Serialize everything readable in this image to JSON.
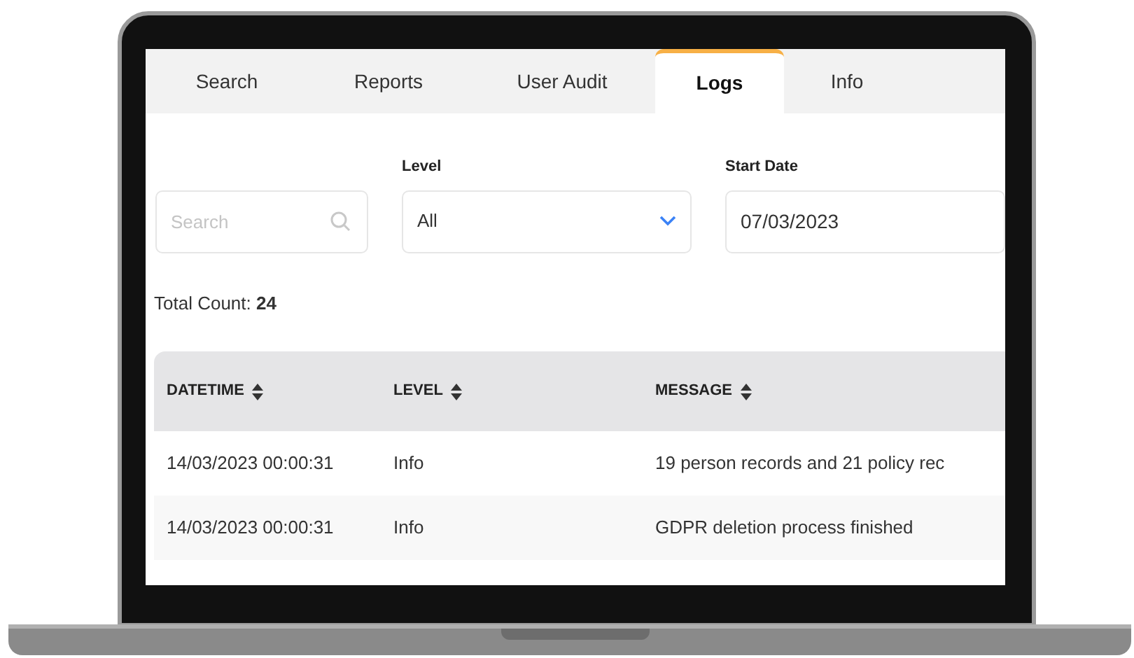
{
  "tabs": [
    {
      "label": "Search",
      "selected": false
    },
    {
      "label": "Reports",
      "selected": false
    },
    {
      "label": "User Audit",
      "selected": false
    },
    {
      "label": "Logs",
      "selected": true
    },
    {
      "label": "Info",
      "selected": false
    }
  ],
  "filters": {
    "search": {
      "placeholder": "Search"
    },
    "level": {
      "label": "Level",
      "value": "All"
    },
    "start_date": {
      "label": "Start Date",
      "value": "07/03/2023"
    }
  },
  "total_count": {
    "label": "Total Count:",
    "value": "24"
  },
  "table": {
    "columns": [
      "DATETIME",
      "LEVEL",
      "MESSAGE"
    ],
    "rows": [
      [
        "14/03/2023 00:00:31",
        "Info",
        "19 person records and 21 policy rec"
      ],
      [
        "14/03/2023 00:00:31",
        "Info",
        "GDPR deletion process finished"
      ]
    ]
  }
}
